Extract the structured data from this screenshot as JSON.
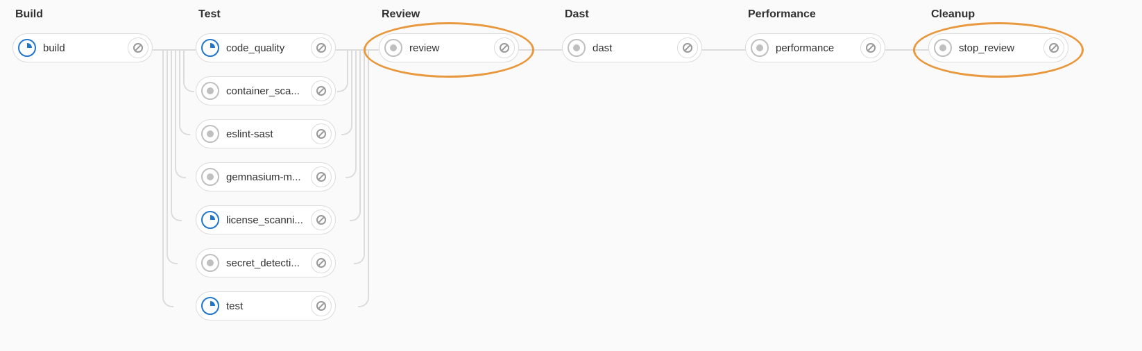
{
  "stages": [
    {
      "name": "Build",
      "jobs": [
        {
          "name": "build",
          "status": "running"
        }
      ]
    },
    {
      "name": "Test",
      "jobs": [
        {
          "name": "code_quality",
          "status": "running"
        },
        {
          "name": "container_sca...",
          "status": "skipped"
        },
        {
          "name": "eslint-sast",
          "status": "skipped"
        },
        {
          "name": "gemnasium-m...",
          "status": "skipped"
        },
        {
          "name": "license_scanni...",
          "status": "running"
        },
        {
          "name": "secret_detecti...",
          "status": "skipped"
        },
        {
          "name": "test",
          "status": "running"
        }
      ]
    },
    {
      "name": "Review",
      "highlight": true,
      "jobs": [
        {
          "name": "review",
          "status": "skipped"
        }
      ]
    },
    {
      "name": "Dast",
      "jobs": [
        {
          "name": "dast",
          "status": "skipped"
        }
      ]
    },
    {
      "name": "Performance",
      "jobs": [
        {
          "name": "performance",
          "status": "skipped"
        }
      ]
    },
    {
      "name": "Cleanup",
      "highlight": true,
      "jobs": [
        {
          "name": "stop_review",
          "status": "skipped"
        }
      ]
    }
  ]
}
